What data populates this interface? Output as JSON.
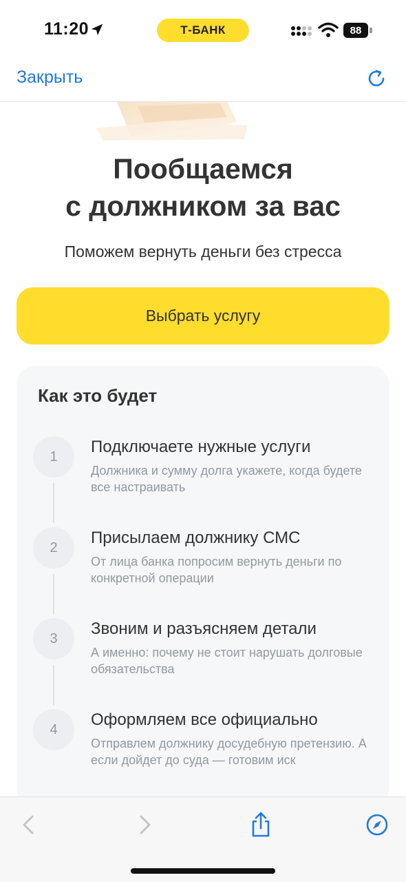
{
  "status_bar": {
    "time": "11:20",
    "brand_pill": "Т-БАНК",
    "battery": "88",
    "icons": [
      "location-arrow-icon",
      "signal-icon",
      "wifi-icon",
      "battery-icon"
    ]
  },
  "nav": {
    "close_label": "Закрыть",
    "reload_icon": "reload-icon"
  },
  "hero": {
    "title_line1": "Пообщаемся",
    "title_line2": "с должником за вас",
    "subtitle": "Поможем вернуть деньги без стресса",
    "cta_label": "Выбрать услугу"
  },
  "steps_card": {
    "title": "Как это будет",
    "steps": [
      {
        "number": "1",
        "title": "Подключаете нужные услуги",
        "desc": "Должника и сумму долга укажете, когда будете все настраивать"
      },
      {
        "number": "2",
        "title": "Присылаем должнику СМС",
        "desc": "От лица банка попросим вернуть деньги по конкретной операции"
      },
      {
        "number": "3",
        "title": "Звоним и разъясняем детали",
        "desc": "А именно: почему не стоит нарушать долговые обязательства"
      },
      {
        "number": "4",
        "title": "Оформляем все официально",
        "desc": "Отправлем должнику досудебную претензию. А если дойдет до суда — готовим иск"
      }
    ]
  },
  "toolbar": {
    "icons": [
      "back-chevron-icon",
      "forward-chevron-icon",
      "share-icon",
      "compass-icon"
    ]
  },
  "colors": {
    "accent_yellow": "#ffdd2d",
    "link_blue": "#1f7ae0",
    "card_bg": "#f6f7f8",
    "muted_text": "#9299a2"
  }
}
